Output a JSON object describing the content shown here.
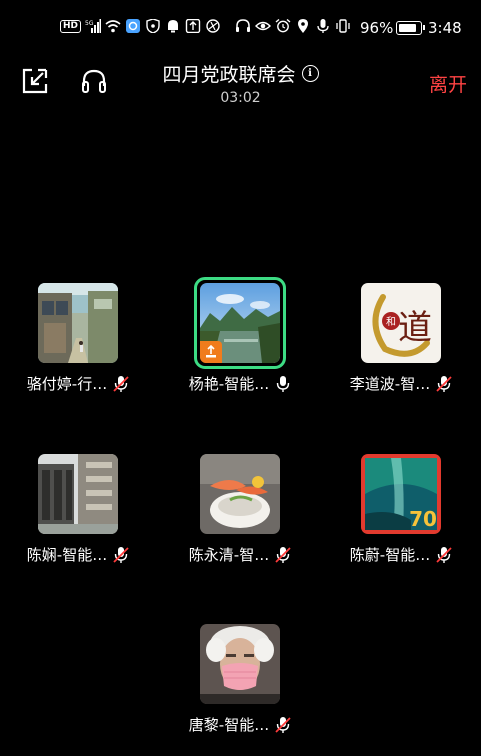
{
  "status_bar": {
    "battery_percent": "96%",
    "time": "3:48",
    "hd_label": "HD",
    "signal_label": "5G",
    "icons": [
      "hd-icon",
      "signal-icon",
      "wifi-icon",
      "qq-browser-icon",
      "shield-icon",
      "notification-icon",
      "upload-icon",
      "vpn-icon",
      "headphones-icon",
      "eye-icon",
      "alarm-icon",
      "location-icon",
      "vibrate-icon",
      "battery-icon"
    ]
  },
  "header": {
    "title": "四月党政联席会",
    "timer": "03:02",
    "leave_label": "离开",
    "info_glyph": "i",
    "leave_color": "#ff4343"
  },
  "participants": [
    {
      "name": "骆付婷-行…",
      "mic": "muted"
    },
    {
      "name": "杨艳-智能…",
      "mic": "on",
      "speaking": true,
      "screen_sharing": true
    },
    {
      "name": "李道波-智…",
      "mic": "muted"
    },
    {
      "name": "陈娴-智能…",
      "mic": "muted"
    },
    {
      "name": "陈永清-智…",
      "mic": "muted"
    },
    {
      "name": "陈蔚-智能…",
      "mic": "muted"
    },
    {
      "name": "唐黎-智能…",
      "mic": "muted"
    }
  ],
  "avatar_texts": {
    "dao": "道",
    "dao_small": "和",
    "seventy": "70"
  },
  "colors": {
    "background": "#000000",
    "speaking_border": "#3ddc84",
    "leave": "#ff4343",
    "share_badge": "#f07c1c"
  }
}
